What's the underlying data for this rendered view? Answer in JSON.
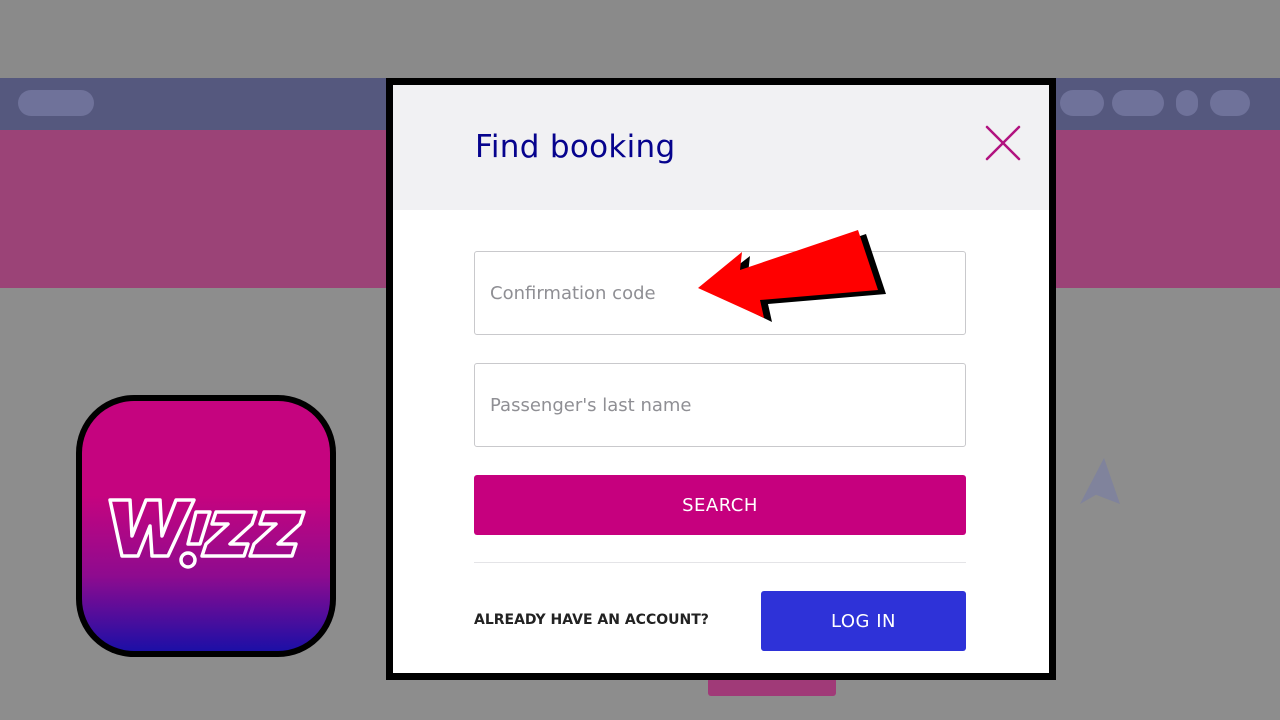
{
  "modal": {
    "title": "Find booking",
    "confirmation_placeholder": "Confirmation code",
    "last_name_placeholder": "Passenger's last name",
    "search_label": "SEARCH",
    "account_prompt": "ALREADY HAVE AN ACCOUNT?",
    "login_label": "LOG IN"
  },
  "app_icon": {
    "logo_text": "Wizz"
  },
  "icons": {
    "close": "close-icon",
    "arrow": "red-arrow-icon",
    "app": "wizz-app-icon"
  },
  "colors": {
    "brand_magenta": "#c6007e",
    "brand_blue": "#2e32d8",
    "title_navy": "#06038d",
    "arrow_red": "#ff0000"
  }
}
